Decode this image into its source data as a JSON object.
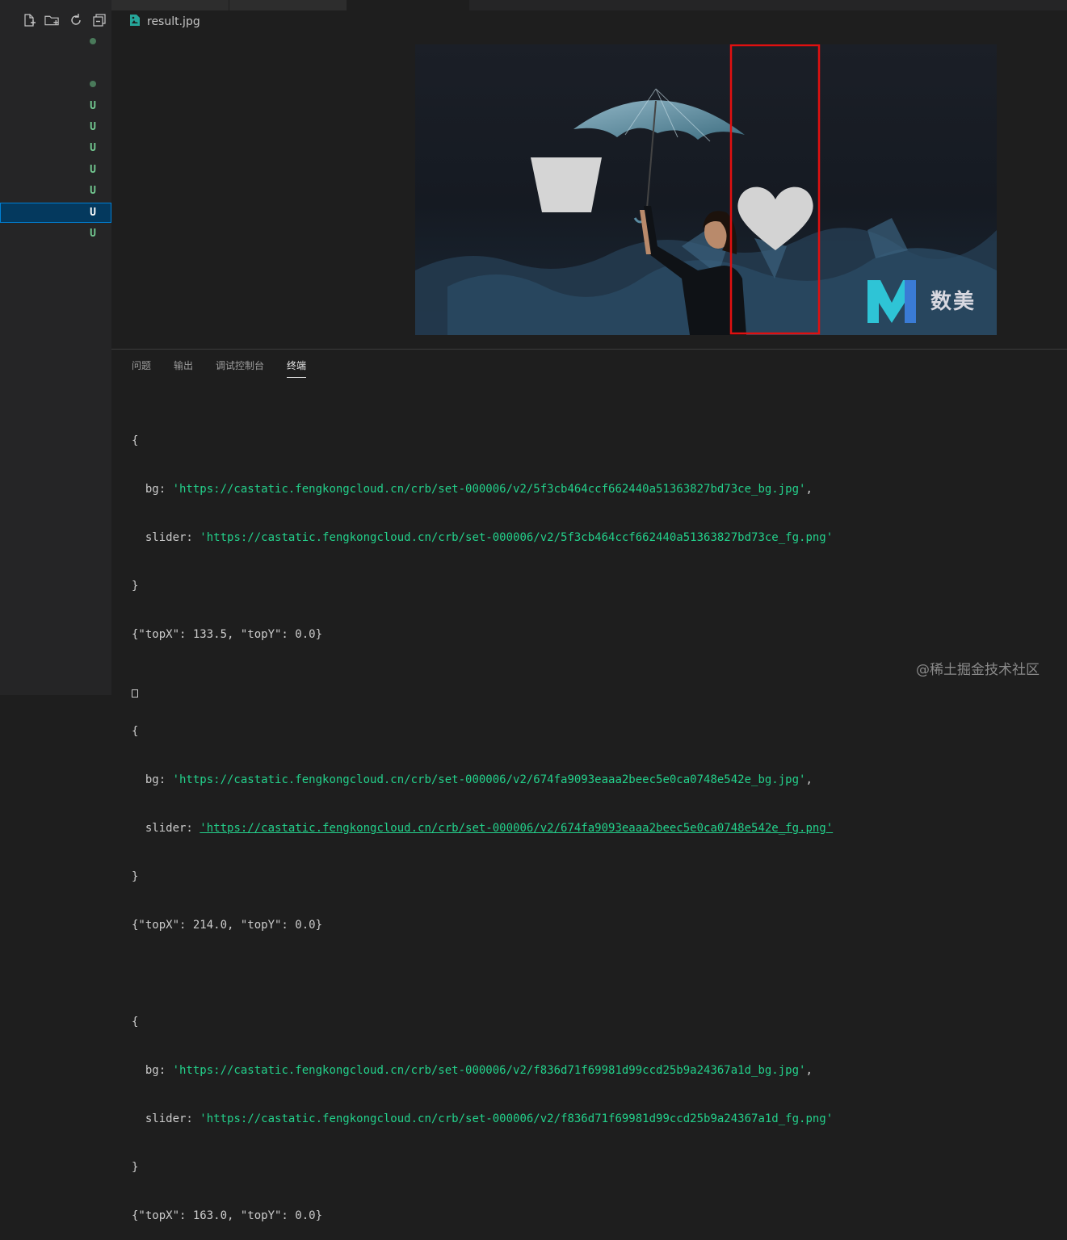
{
  "sidebar": {
    "actions": [
      {
        "icon": "new-file-icon"
      },
      {
        "icon": "new-folder-icon"
      },
      {
        "icon": "refresh-icon"
      },
      {
        "icon": "collapse-all-icon"
      }
    ],
    "status_rows": [
      {
        "mark": "",
        "dot": true
      },
      {
        "mark": "",
        "dot": false
      },
      {
        "mark": "",
        "dot": true
      },
      {
        "mark": "U",
        "dot": false
      },
      {
        "mark": "U",
        "dot": false
      },
      {
        "mark": "U",
        "dot": false
      },
      {
        "mark": "U",
        "dot": false
      },
      {
        "mark": "U",
        "dot": false
      },
      {
        "mark": "U",
        "dot": false,
        "selected": true
      },
      {
        "mark": "U",
        "dot": false
      }
    ]
  },
  "editor": {
    "file_name": "result.jpg",
    "file_icon": "image-file-icon"
  },
  "image": {
    "watermark_logo": "数美"
  },
  "panel": {
    "tabs": [
      "问题",
      "输出",
      "调试控制台",
      "终端"
    ],
    "active_tab": 3
  },
  "terminal": {
    "blocks": [
      {
        "open": "{",
        "bg_key": "  bg: ",
        "bg_url": "'https://castatic.fengkongcloud.cn/crb/set-000006/v2/5f3cb464ccf662440a51363827bd73ce_bg.jpg'",
        "slider_key": "  slider: ",
        "slider_url": "'https://castatic.fengkongcloud.cn/crb/set-000006/v2/5f3cb464ccf662440a51363827bd73ce_fg.png'",
        "close": "}",
        "result": "{\"topX\": 133.5, \"topY\": 0.0}"
      },
      {
        "open": "{",
        "bg_key": "  bg: ",
        "bg_url": "'https://castatic.fengkongcloud.cn/crb/set-000006/v2/674fa9093eaaa2beec5e0ca0748e542e_bg.jpg'",
        "slider_key": "  slider: ",
        "slider_url": "'https://castatic.fengkongcloud.cn/crb/set-000006/v2/674fa9093eaaa2beec5e0ca0748e542e_fg.png'",
        "close": "}",
        "result": "{\"topX\": 214.0, \"topY\": 0.0}"
      },
      {
        "open": "{",
        "bg_key": "  bg: ",
        "bg_url": "'https://castatic.fengkongcloud.cn/crb/set-000006/v2/f836d71f69981d99ccd25b9a24367a1d_bg.jpg'",
        "slider_key": "  slider: ",
        "slider_url": "'https://castatic.fengkongcloud.cn/crb/set-000006/v2/f836d71f69981d99ccd25b9a24367a1d_fg.png'",
        "close": "}",
        "result": "{\"topX\": 163.0, \"topY\": 0.0}"
      }
    ]
  },
  "site_watermark": "@稀土掘金技术社区",
  "colors": {
    "string": "#23d18b",
    "selection": "#04395e",
    "untracked": "#73c991",
    "highlight_box": "#e01010"
  }
}
